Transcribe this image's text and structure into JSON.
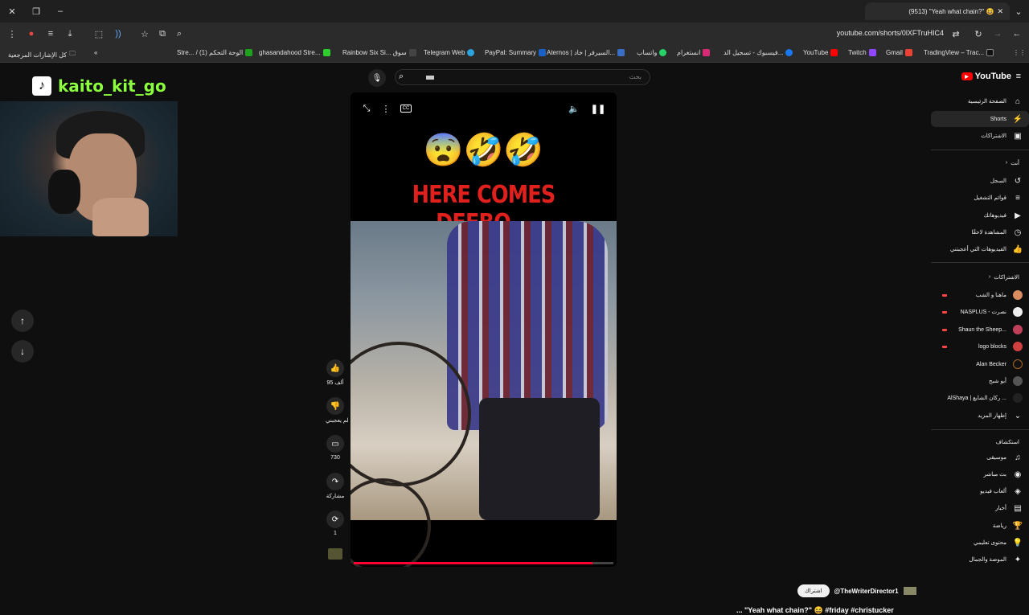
{
  "browser": {
    "tab_title": "(9513) \"Yeah what chain?\" 😆",
    "url": "youtube.com/shorts/0lXFTruHIC4",
    "bookmarks": [
      {
        "label": "كل الإشارات المرجعية",
        "color": "#888888"
      },
      {
        "label": "Stre... / (1) الوحة التحكم",
        "color": "#1fa01f"
      },
      {
        "label": "ghasandahood Stre...",
        "color": "#2fcc2f"
      },
      {
        "label": "Rainbow Six Si... سوق",
        "color": "#444444"
      },
      {
        "label": "Telegram Web",
        "color": "#2aa3df"
      },
      {
        "label": "PayPal: Summary",
        "color": "#1a5fc4"
      },
      {
        "label": "Aternos | السيرفر | خاد...",
        "color": "#3a6ec4"
      },
      {
        "label": "واتساب",
        "color": "#25d366"
      },
      {
        "label": "انستغرام",
        "color": "#d62976"
      },
      {
        "label": "فيسبوك - تسجيل الد...",
        "color": "#1877f2"
      },
      {
        "label": "YouTube",
        "color": "#ff0000"
      },
      {
        "label": "Twitch",
        "color": "#9146ff"
      },
      {
        "label": "Gmail",
        "color": "#ea4335"
      },
      {
        "label": "TradingView – Trac...",
        "color": "#222222"
      }
    ]
  },
  "search": {
    "placeholder": "بحث"
  },
  "overlay": {
    "tiktok_handle": "kaito_kit_go"
  },
  "video": {
    "emojis": "😨🤣🤣",
    "caption": "HERE COMES DEEBO...",
    "progress": 0.92
  },
  "actions": {
    "like_count": "95 ألف",
    "dislike_label": "لم يعجبني",
    "comment_count": "730",
    "share_label": "مشاركة",
    "remix_count": "1"
  },
  "channel": {
    "handle": "@TheWriterDirector1",
    "subscribe_label": "اشتراك",
    "title": "... \"Yeah what chain?\" 😆 #friday #christucker"
  },
  "sidebar": {
    "brand": "YouTube",
    "main": [
      {
        "label": "الصفحة الرئيسية",
        "icon": "home-icon",
        "glyph": "⌂"
      },
      {
        "label": "Shorts",
        "icon": "shorts-icon",
        "glyph": "⚡"
      },
      {
        "label": "الاشتراكات",
        "icon": "subscriptions-icon",
        "glyph": "▣"
      }
    ],
    "you_header": "أنت",
    "you": [
      {
        "label": "السجل",
        "icon": "history-icon",
        "glyph": "↺"
      },
      {
        "label": "قوائم التشغيل",
        "icon": "playlists-icon",
        "glyph": "≡"
      },
      {
        "label": "فيديوهاتك",
        "icon": "your-videos-icon",
        "glyph": "▶"
      },
      {
        "label": "المشاهدة لاحقًا",
        "icon": "watch-later-icon",
        "glyph": "◷"
      },
      {
        "label": "الفيديوهات التي أعجبتني",
        "icon": "liked-videos-icon",
        "glyph": "👍"
      }
    ],
    "subs_header": "الاشتراكات",
    "subs": [
      {
        "label": "ماهنا و الشب",
        "color": "#d98c5f"
      },
      {
        "label": "NASPLUS - نصرت",
        "color": "#eeeeee"
      },
      {
        "label": "Shaun the Sheep...",
        "color": "#c0405a"
      },
      {
        "label": "logo blocks",
        "color": "#d04040"
      },
      {
        "label": "Alan Becker",
        "color": "#111111"
      },
      {
        "label": "أبو شبح",
        "color": "#555555"
      },
      {
        "label": "AlShaya | ركان الشايع ...",
        "color": "#222222"
      }
    ],
    "show_more": "إظهار المزيد",
    "explore_header": "استكشاف",
    "explore": [
      {
        "label": "موسيقى",
        "icon": "music-icon",
        "glyph": "♫"
      },
      {
        "label": "بث مباشر",
        "icon": "live-icon",
        "glyph": "◉"
      },
      {
        "label": "ألعاب فيديو",
        "icon": "gaming-icon",
        "glyph": "◈"
      },
      {
        "label": "أخبار",
        "icon": "news-icon",
        "glyph": "▤"
      },
      {
        "label": "رياضة",
        "icon": "sports-icon",
        "glyph": "🏆"
      },
      {
        "label": "محتوى تعليمي",
        "icon": "learning-icon",
        "glyph": "💡"
      },
      {
        "label": "الموضة والجمال",
        "icon": "fashion-icon",
        "glyph": "✦"
      }
    ]
  }
}
